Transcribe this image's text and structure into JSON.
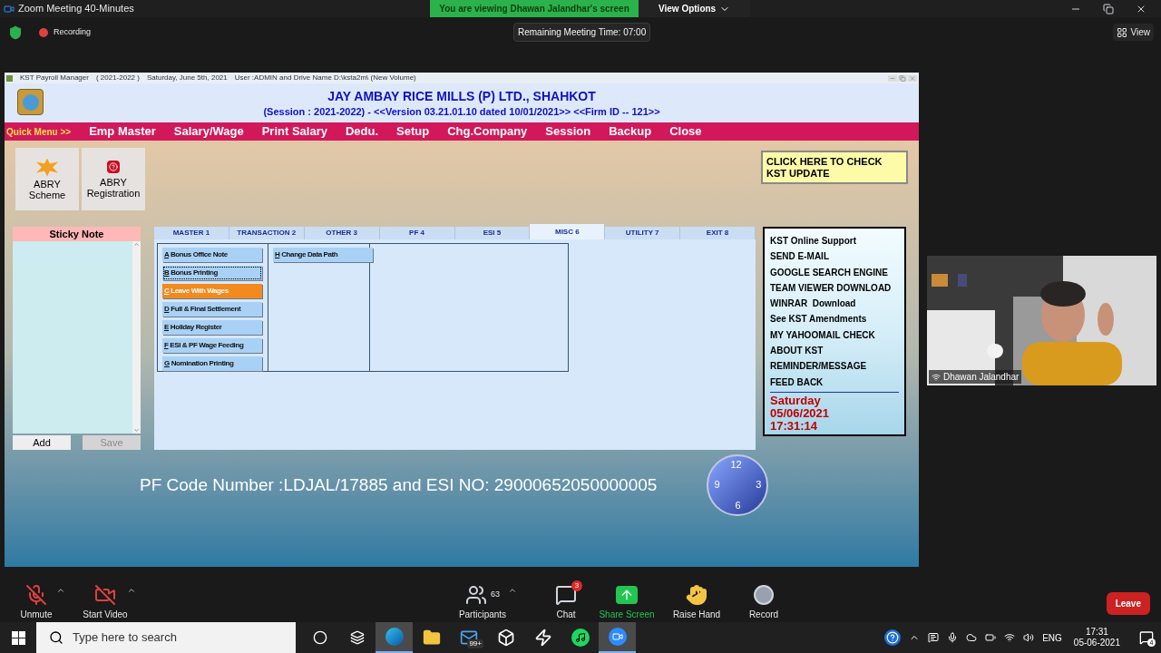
{
  "zoom_window": {
    "title": "Zoom Meeting 40-Minutes",
    "viewing_banner": "You are viewing Dhawan Jalandhar's screen",
    "view_options": "View Options"
  },
  "meeting_bar": {
    "recording": "Recording",
    "remaining_time": "Remaining Meeting Time: 07:00",
    "view": "View"
  },
  "app": {
    "title_bar": [
      "KST Payroll Manager",
      "( 2021-2022 )",
      "Saturday, June 5th, 2021",
      "User :ADMIN and Drive Name D:\\ksta2m\\ (New Volume)"
    ],
    "company": "JAY AMBAY RICE MILLS (P) LTD., SHAHKOT",
    "session": "(Session : 2021-2022) - <<Version 03.21.01.10 dated 10/01/2021>> <<Firm ID -- 121>>",
    "quick_menu_label": "Quick Menu >>",
    "menu": [
      "Emp Master",
      "Salary/Wage",
      "Print Salary",
      "Dedu.",
      "Setup",
      "Chg.Company",
      "Session",
      "Backup",
      "Close"
    ],
    "shortcuts": [
      {
        "label": "ABRY Scheme",
        "kind": "new"
      },
      {
        "label": "ABRY Registration",
        "kind": "help"
      }
    ],
    "update_notice": "CLICK HERE TO CHECK KST UPDATE",
    "sticky_note": {
      "title": "Sticky Note",
      "buttons": [
        {
          "label": "Add",
          "disabled": false
        },
        {
          "label": "Save",
          "disabled": true
        }
      ]
    },
    "tabs": [
      {
        "label": "MASTER 1",
        "selected": false
      },
      {
        "label": "TRANSACTION 2",
        "selected": false
      },
      {
        "label": "OTHER 3",
        "selected": false
      },
      {
        "label": "PF 4",
        "selected": false
      },
      {
        "label": "ESI 5",
        "selected": false
      },
      {
        "label": "MISC 6",
        "selected": true
      },
      {
        "label": "UTILITY 7",
        "selected": false
      },
      {
        "label": "EXIT 8",
        "selected": false
      }
    ],
    "columns": [
      [
        {
          "key": "A",
          "label": "Bonus Office Note",
          "selected": false,
          "focused": false
        },
        {
          "key": "B",
          "label": "Bonus Printing",
          "selected": false,
          "focused": true
        },
        {
          "key": "C",
          "label": "Leave With Wages",
          "selected": true,
          "focused": false
        },
        {
          "key": "D",
          "label": "Full & Final Settlement",
          "selected": false,
          "focused": false
        },
        {
          "key": "E",
          "label": "Holiday Register",
          "selected": false,
          "focused": false
        },
        {
          "key": "F",
          "label": "ESI & PF Wage Feeding",
          "selected": false,
          "focused": false
        },
        {
          "key": "G",
          "label": "Nomination Printing",
          "selected": false,
          "focused": false
        }
      ],
      [
        {
          "key": "H",
          "label": "Change Data Path",
          "selected": false,
          "focused": false
        }
      ]
    ],
    "links": [
      "KST Online Support",
      "SEND E-MAIL",
      "GOOGLE SEARCH ENGINE",
      "TEAM VIEWER DOWNLOAD",
      "WINRAR  Download",
      "See KST Amendments",
      "MY YAHOOMAIL CHECK",
      "ABOUT KST",
      "REMINDER/MESSAGE",
      "FEED BACK"
    ],
    "day": "Saturday",
    "date": "05/06/2021",
    "time": "17:31:14",
    "codes": "PF Code Number :LDJAL/17885 and ESI NO: 29000652050000005",
    "clock_numerals": [
      "12",
      "3",
      "6",
      "9"
    ]
  },
  "video": {
    "name": "Dhawan Jalandhar"
  },
  "toolbar": [
    {
      "label": "Unmute",
      "kind": "mic",
      "caret": true
    },
    {
      "label": "Start Video",
      "kind": "video",
      "caret": true
    },
    {
      "label": "Participants",
      "kind": "participants",
      "count": "63",
      "caret": true
    },
    {
      "label": "Chat",
      "kind": "chat",
      "badge": "3"
    },
    {
      "label": "Share Screen",
      "kind": "share"
    },
    {
      "label": "Raise Hand",
      "kind": "hand"
    },
    {
      "label": "Record",
      "kind": "record"
    }
  ],
  "leave": "Leave",
  "taskbar": {
    "search_placeholder": "Type here to search",
    "apps": [
      {
        "kind": "cortana",
        "active": false
      },
      {
        "kind": "taskview",
        "active": false
      },
      {
        "kind": "edge",
        "active": true
      },
      {
        "kind": "explorer",
        "active": false
      },
      {
        "kind": "mail",
        "active": false,
        "badge": "99+"
      },
      {
        "kind": "dropbox",
        "active": false
      },
      {
        "kind": "bolt",
        "active": false
      },
      {
        "kind": "spotify",
        "active": false
      },
      {
        "kind": "zoom",
        "active": true
      }
    ],
    "language": "ENG",
    "time": "17:31",
    "date": "05-06-2021",
    "notifications": "4"
  }
}
